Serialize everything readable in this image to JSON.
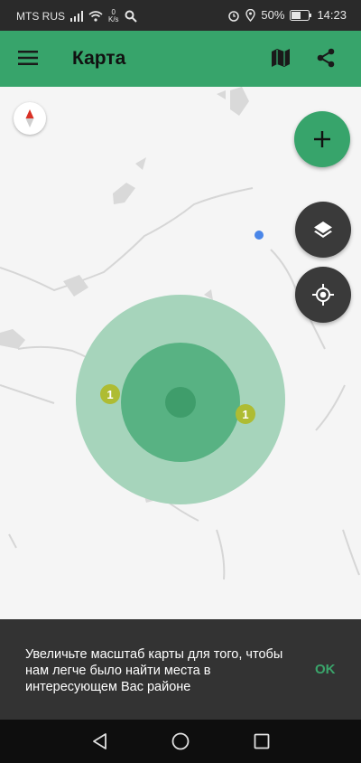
{
  "status": {
    "carrier": "MTS RUS",
    "speed_value": "0",
    "speed_unit": "K/s",
    "battery": "50%",
    "time": "14:23",
    "icons": [
      "signal-icon",
      "wifi-icon",
      "search-icon",
      "alarm-icon",
      "location-icon",
      "battery-icon"
    ]
  },
  "appbar": {
    "title": "Карта",
    "icons": [
      "menu-icon",
      "map-icon",
      "share-icon"
    ]
  },
  "map": {
    "clusters": [
      {
        "label": "1"
      },
      {
        "label": "1"
      }
    ],
    "colors": {
      "outer_circle": "#a6d4bb",
      "middle_circle": "#58b283",
      "inner_circle": "#3f9d6b",
      "cluster": "#aebc33",
      "user_dot": "#4a86e8"
    }
  },
  "fabs": {
    "icons": [
      "plus-icon",
      "layers-icon",
      "crosshair-icon"
    ],
    "accent": "#37a46b",
    "dark": "#3a3a3a"
  },
  "snackbar": {
    "message": "Увеличьте масштаб карты для того, чтобы нам легче было найти места в интересующем Вас районе",
    "action": "OK"
  },
  "navbar": {
    "icons": [
      "back-icon",
      "home-icon",
      "recents-icon"
    ]
  }
}
